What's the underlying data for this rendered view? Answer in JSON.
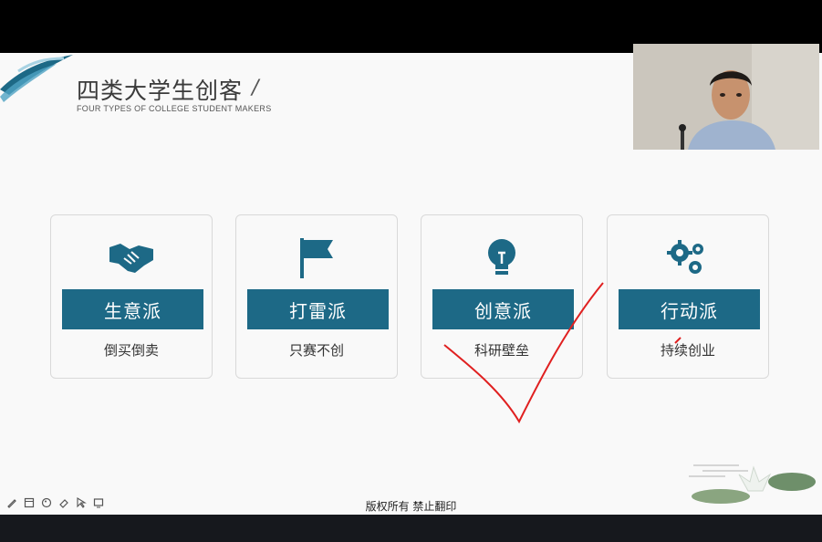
{
  "slide": {
    "title": "四类大学生创客",
    "title_slash": "/",
    "subtitle": "FOUR TYPES OF COLLEGE STUDENT MAKERS",
    "footer": "版权所有  禁止翻印"
  },
  "cards": [
    {
      "icon": "handshake-icon",
      "label": "生意派",
      "desc": "倒买倒卖"
    },
    {
      "icon": "flag-icon",
      "label": "打雷派",
      "desc": "只赛不创"
    },
    {
      "icon": "lightbulb-icon",
      "label": "创意派",
      "desc": "科研壁垒"
    },
    {
      "icon": "gears-icon",
      "label": "行动派",
      "desc": "持续创业"
    }
  ],
  "colors": {
    "accent": "#1d6986",
    "annotation": "#e02020"
  },
  "toolbar": [
    "pen-icon",
    "window-icon",
    "palette-icon",
    "eraser-icon",
    "pointer-icon",
    "screen-icon"
  ]
}
